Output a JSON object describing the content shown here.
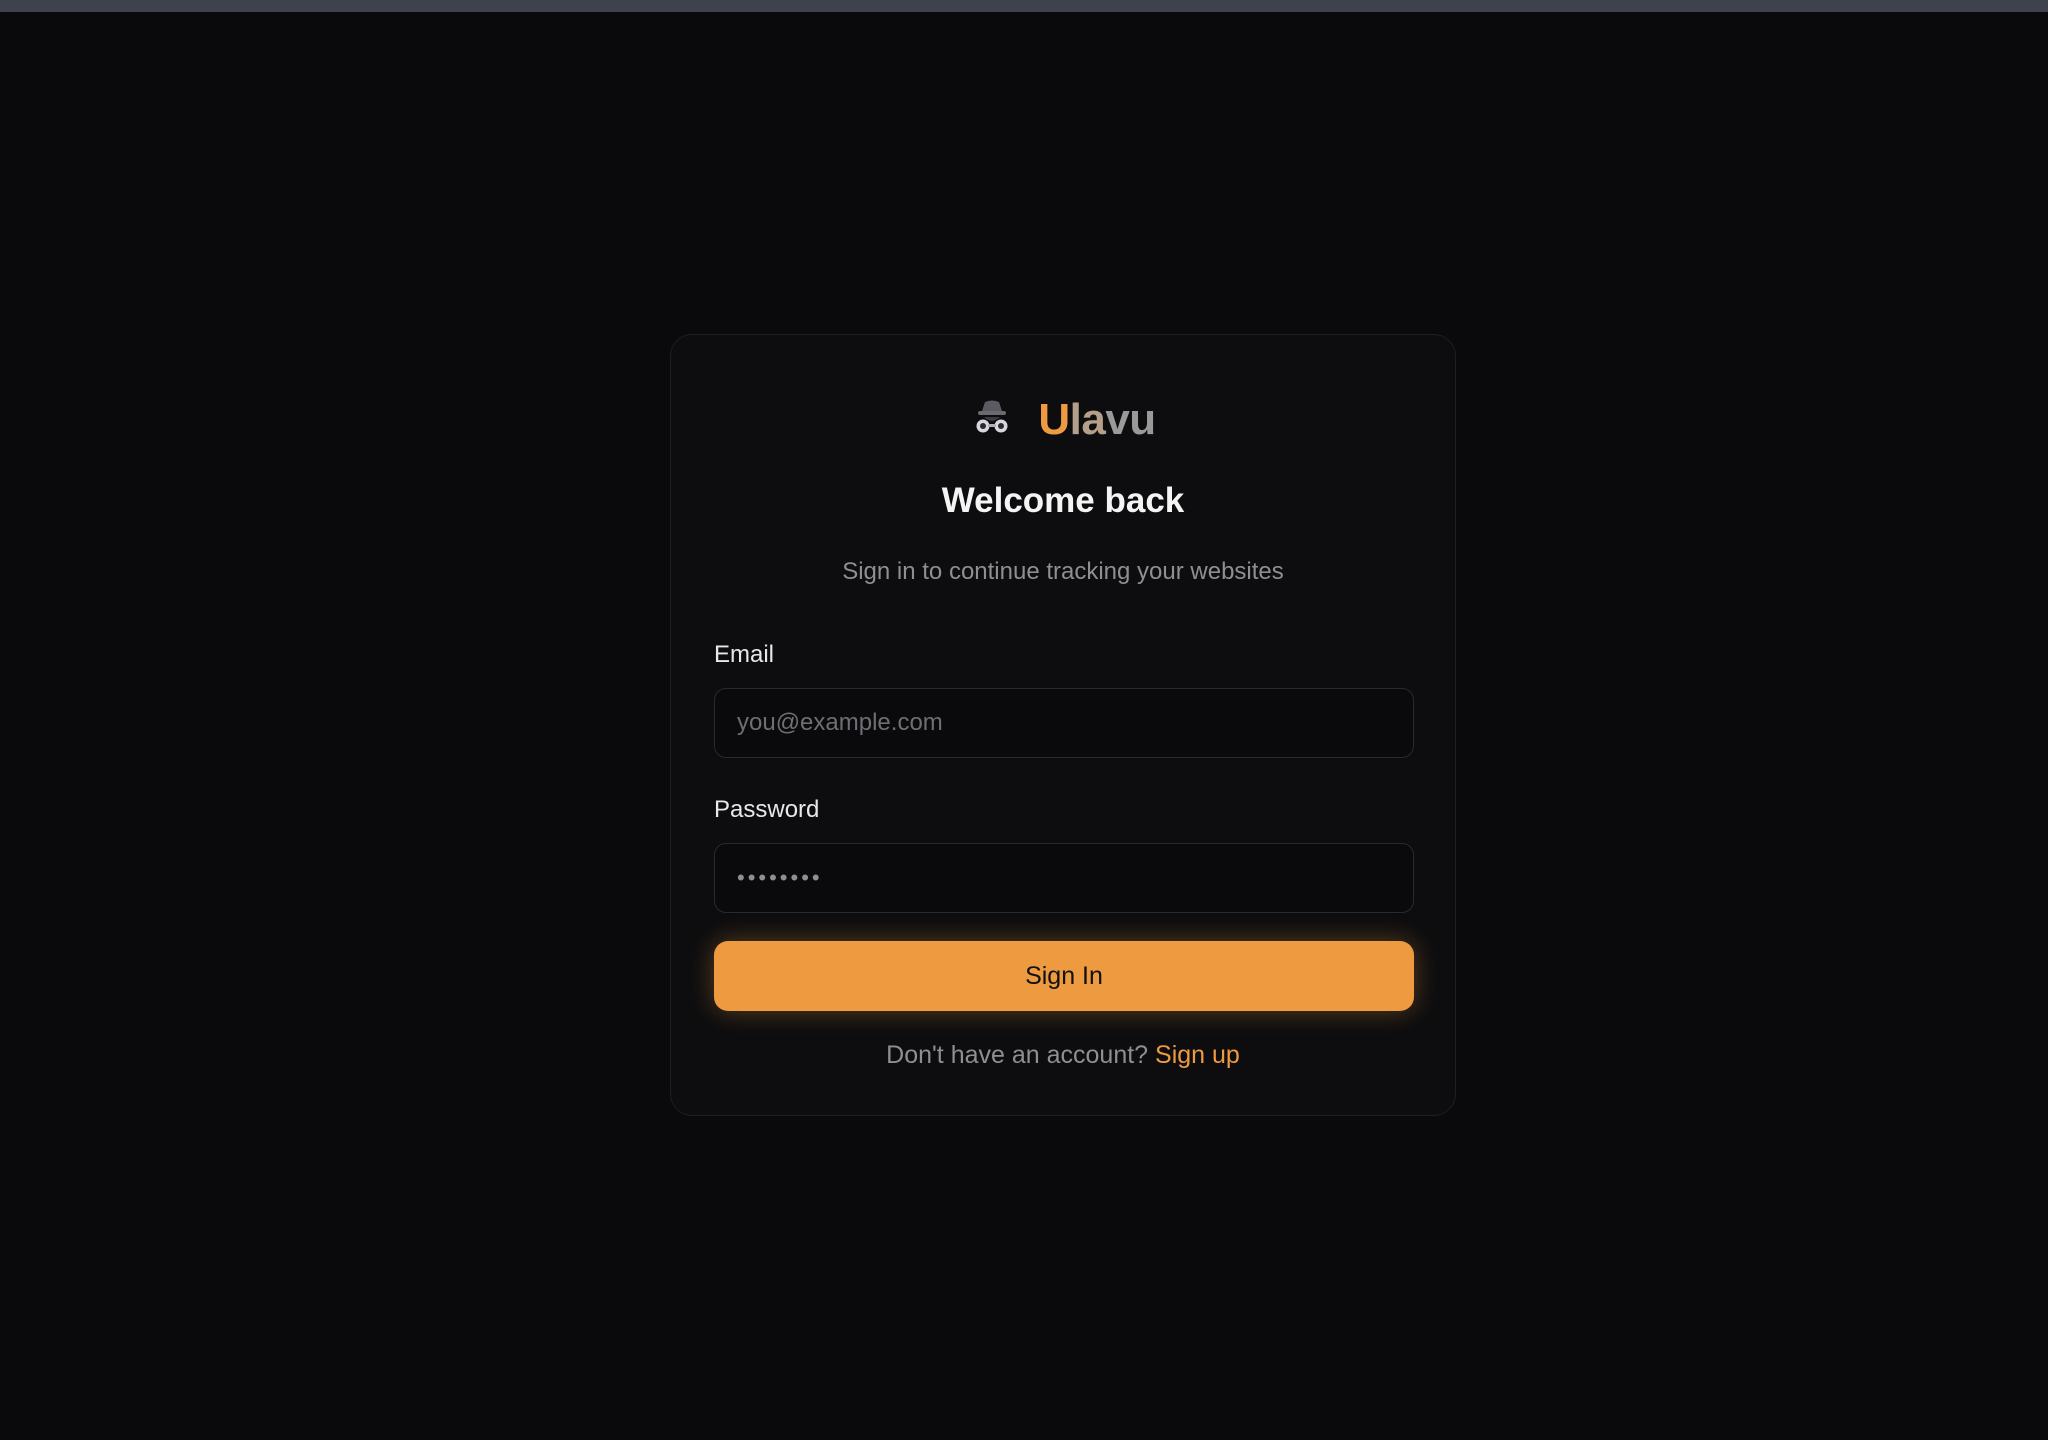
{
  "brand": {
    "name_part1": "U",
    "name_part2": "la",
    "name_part3": "vu",
    "icon": "spy-icon"
  },
  "login": {
    "title": "Welcome back",
    "subtitle": "Sign in to continue tracking your websites",
    "email_label": "Email",
    "email_placeholder": "you@example.com",
    "password_label": "Password",
    "password_value": "••••••••",
    "submit_label": "Sign In",
    "footer_text": "Don't have an account?",
    "signup_link": "Sign up"
  },
  "colors": {
    "accent": "#ee9a40",
    "background": "#0a0a0c",
    "card": "#0d0d0f"
  }
}
